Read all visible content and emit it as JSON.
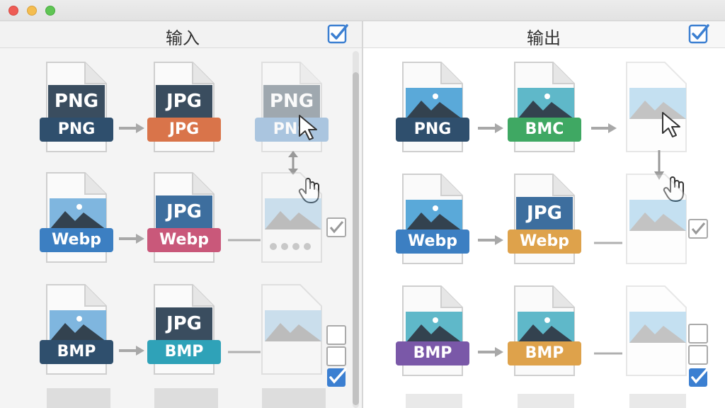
{
  "window": {
    "controls": [
      "close",
      "minimize",
      "zoom"
    ]
  },
  "input_pane": {
    "title": "输入",
    "header_checked": true,
    "rows": [
      {
        "source": {
          "top": "PNG",
          "ribbon": "PNG",
          "color": "#2f4f6d"
        },
        "target": {
          "top": "JPG",
          "ribbon": "JPG",
          "color": "#d9744a"
        },
        "preview": {
          "top": "PNG",
          "ribbon": "PNG",
          "color": "#6ea0cf"
        }
      },
      {
        "source": {
          "ribbon": "Webp",
          "color": "#3c7fc2"
        },
        "target": {
          "top": "JPG",
          "ribbon": "Webp",
          "color": "#c9587a"
        }
      },
      {
        "source": {
          "ribbon": "BMP",
          "color": "#2f4f6d"
        },
        "target": {
          "top": "JPG",
          "ribbon": "BMP",
          "color": "#2fa2b8"
        }
      }
    ]
  },
  "output_pane": {
    "title": "输出",
    "header_checked": true,
    "rows": [
      {
        "source": {
          "ribbon": "PNG",
          "color": "#2f4f6d"
        },
        "target": {
          "ribbon": "BMC",
          "color": "#3fa863"
        }
      },
      {
        "source": {
          "ribbon": "Webp",
          "color": "#3c7fc2"
        },
        "target": {
          "top": "JPG",
          "ribbon": "Webp",
          "color": "#dea24b"
        }
      },
      {
        "source": {
          "ribbon": "BMP",
          "color": "#7a58a8"
        },
        "target": {
          "ribbon": "BMP",
          "color": "#dea24b"
        }
      }
    ]
  },
  "icons": {
    "accent": "#3b7fd1",
    "arrow_color": "#a8a8a8"
  }
}
